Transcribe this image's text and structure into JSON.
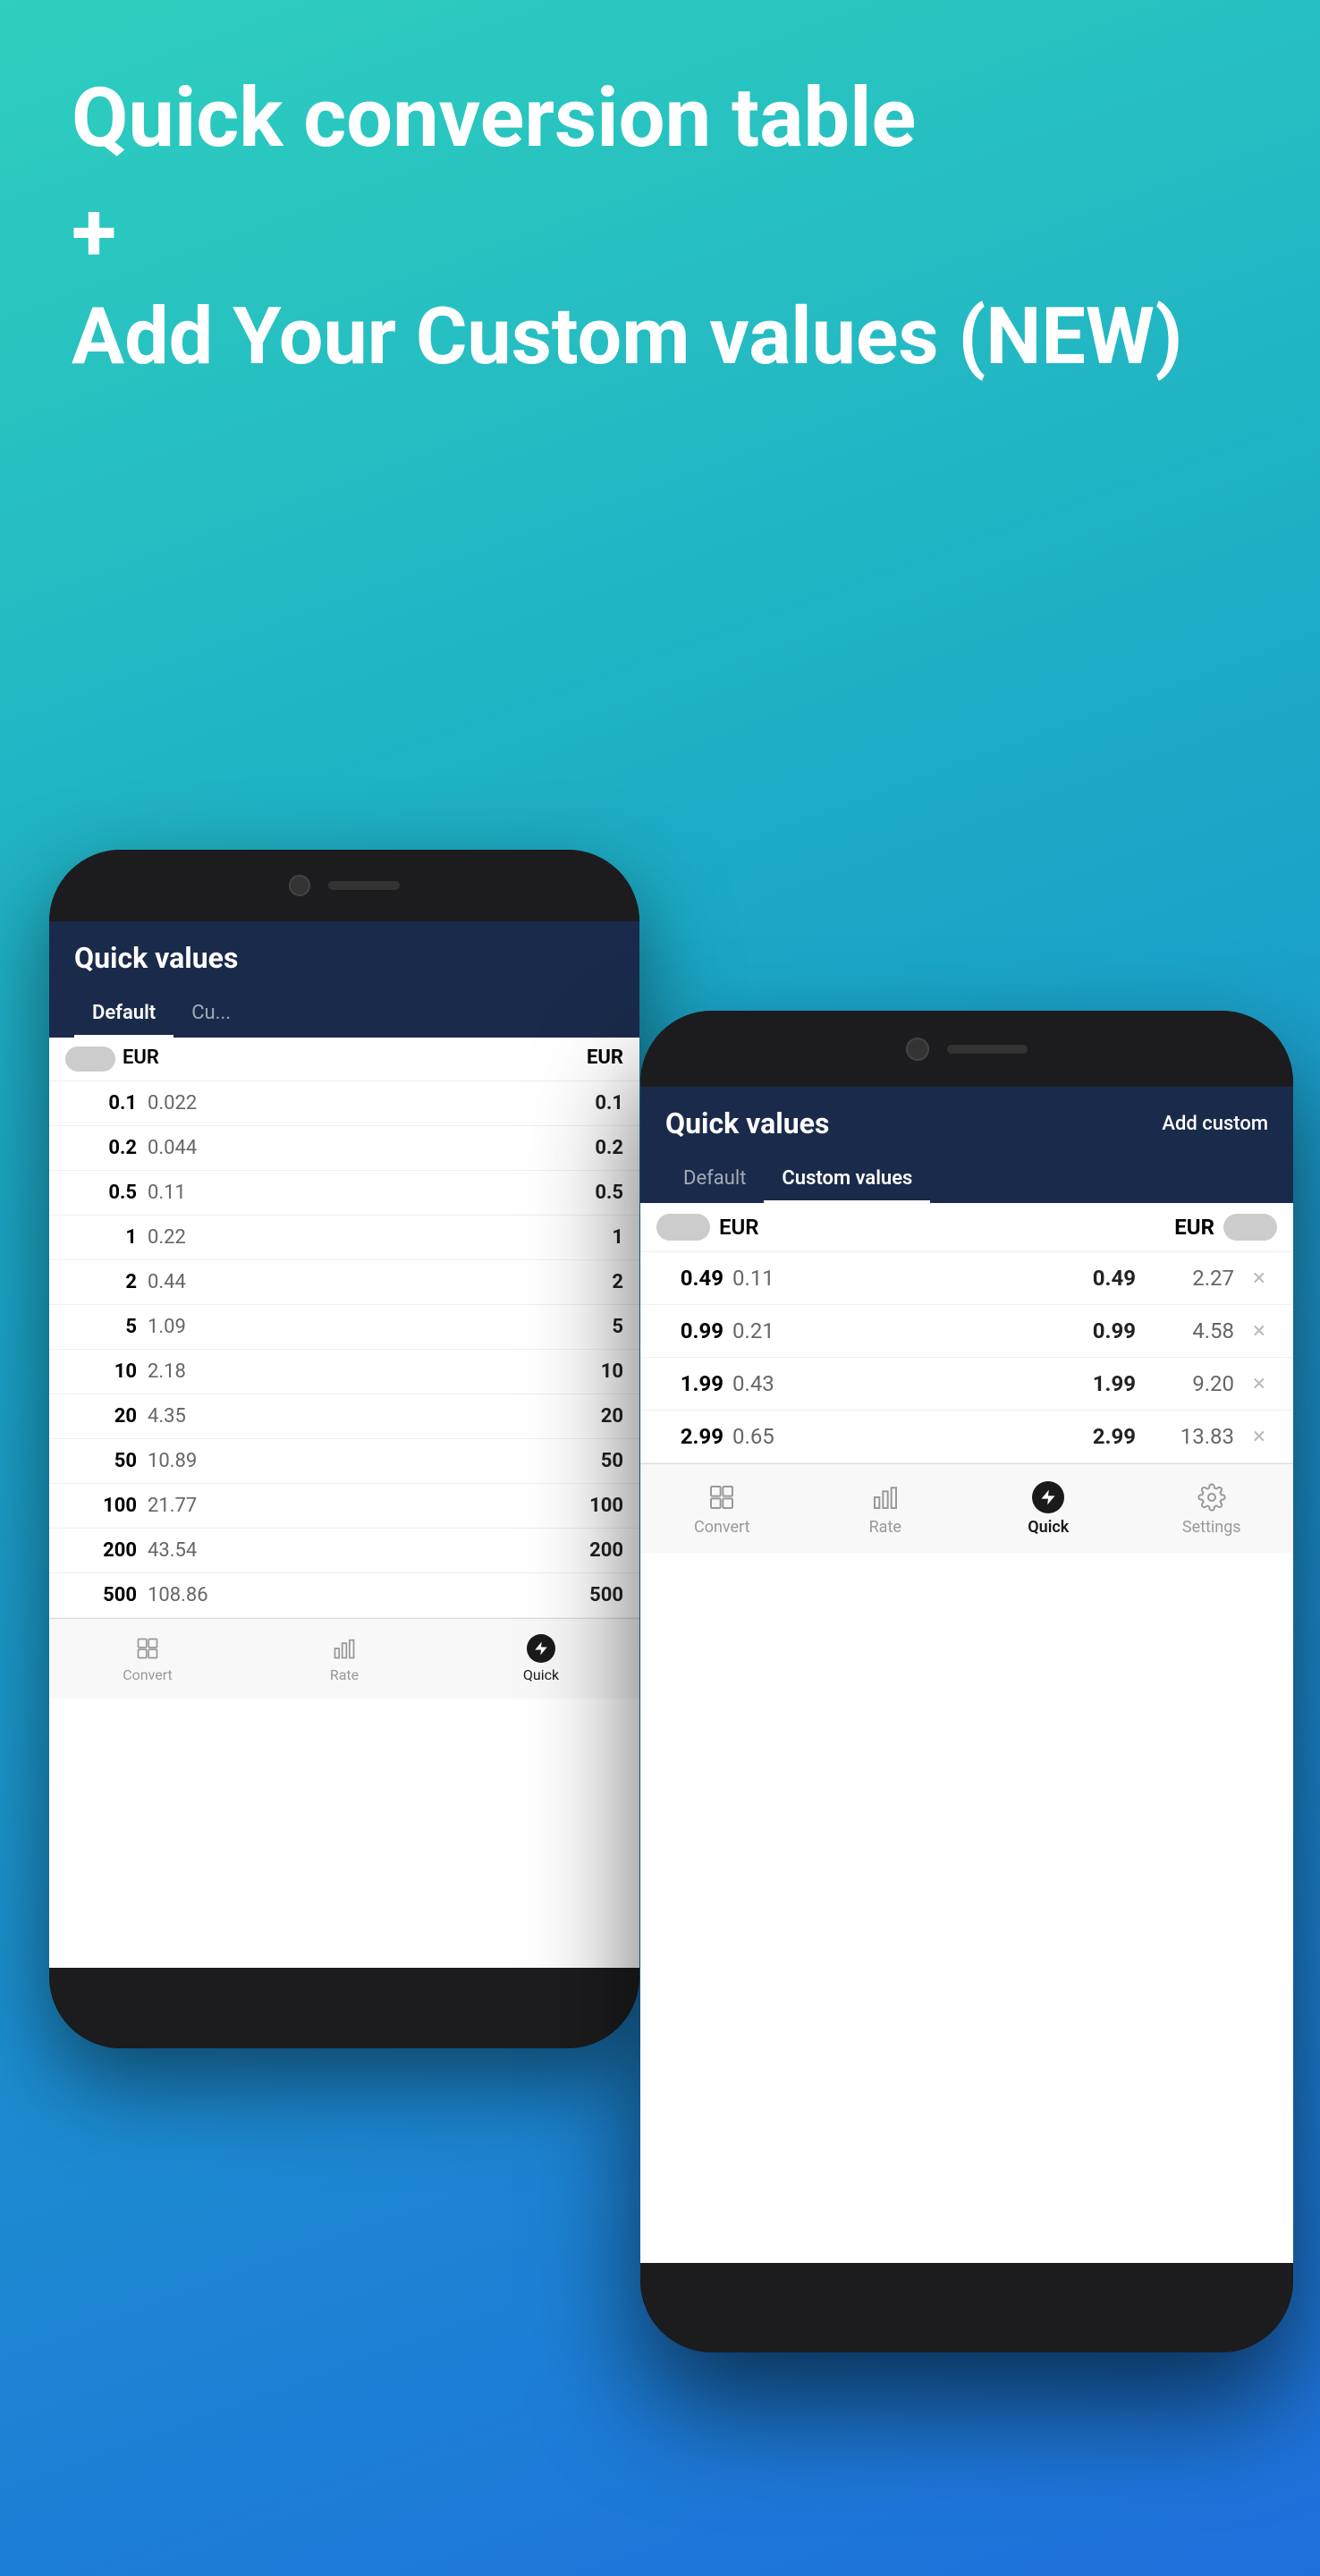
{
  "hero": {
    "title": "Quick conversion table",
    "plus": "+",
    "subtitle": "Add Your Custom values (NEW)"
  },
  "phone_back": {
    "app_title": "Quick values",
    "tabs": [
      {
        "label": "Default",
        "active": true
      },
      {
        "label": "Cu...",
        "active": false
      }
    ],
    "header_currency_left": "EUR",
    "header_currency_right": "EUR",
    "rows": [
      {
        "val1": "0.1",
        "val2": "0.022",
        "val3": "0.1"
      },
      {
        "val1": "0.2",
        "val2": "0.044",
        "val3": "0.2"
      },
      {
        "val1": "0.5",
        "val2": "0.11",
        "val3": "0.5"
      },
      {
        "val1": "1",
        "val2": "0.22",
        "val3": "1"
      },
      {
        "val1": "2",
        "val2": "0.44",
        "val3": "2"
      },
      {
        "val1": "5",
        "val2": "1.09",
        "val3": "5"
      },
      {
        "val1": "10",
        "val2": "2.18",
        "val3": "10"
      },
      {
        "val1": "20",
        "val2": "4.35",
        "val3": "20"
      },
      {
        "val1": "50",
        "val2": "10.89",
        "val3": "50"
      },
      {
        "val1": "100",
        "val2": "21.77",
        "val3": "100"
      },
      {
        "val1": "200",
        "val2": "43.54",
        "val3": "200"
      },
      {
        "val1": "500",
        "val2": "108.86",
        "val3": "500"
      }
    ],
    "nav": [
      {
        "label": "Convert",
        "active": false
      },
      {
        "label": "Rate",
        "active": false
      },
      {
        "label": "Quick",
        "active": true
      }
    ]
  },
  "phone_front": {
    "app_title": "Quick values",
    "add_custom_label": "Add custom",
    "tabs": [
      {
        "label": "Default",
        "active": false
      },
      {
        "label": "Custom values",
        "active": true
      }
    ],
    "header_currency_left": "EUR",
    "header_currency_right": "EUR",
    "rows": [
      {
        "val1": "0.49",
        "val2": "0.11",
        "val3": "0.49",
        "val4": "2.27"
      },
      {
        "val1": "0.99",
        "val2": "0.21",
        "val3": "0.99",
        "val4": "4.58"
      },
      {
        "val1": "1.99",
        "val2": "0.43",
        "val3": "1.99",
        "val4": "9.20"
      },
      {
        "val1": "2.99",
        "val2": "0.65",
        "val3": "2.99",
        "val4": "13.83"
      }
    ],
    "nav": [
      {
        "label": "Convert",
        "active": false
      },
      {
        "label": "Rate",
        "active": false
      },
      {
        "label": "Quick",
        "active": true
      },
      {
        "label": "Settings",
        "active": false
      }
    ]
  }
}
